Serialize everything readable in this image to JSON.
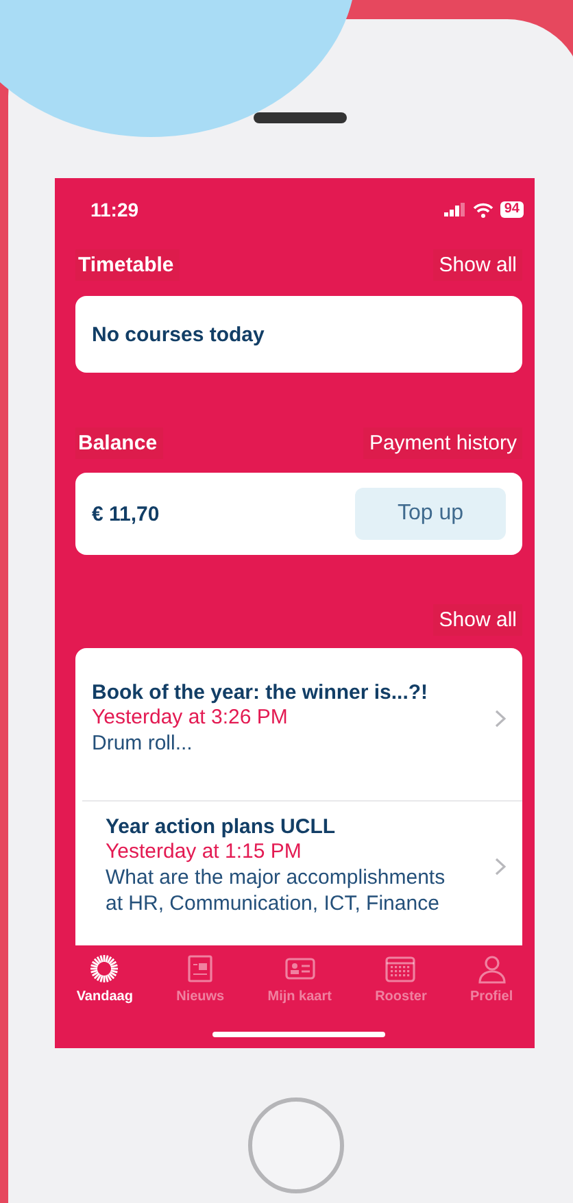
{
  "status_bar": {
    "time": "11:29",
    "battery": "94"
  },
  "timetable": {
    "title": "Timetable",
    "action": "Show all",
    "message": "No courses today"
  },
  "balance": {
    "title": "Balance",
    "action": "Payment history",
    "amount": "€ 11,70",
    "button": "Top up"
  },
  "news": {
    "action": "Show all",
    "items": [
      {
        "title": "Book of the year: the winner is...?!",
        "time": "Yesterday at 3:26 PM",
        "summary": "Drum roll..."
      },
      {
        "title": "Year action plans UCLL",
        "time": "Yesterday at 1:15 PM",
        "summary": "What are the major accomplishments at HR, Communication, ICT, Finance"
      }
    ]
  },
  "tab_bar": [
    {
      "kind": "sun",
      "label": "Vandaag",
      "selected": true
    },
    {
      "kind": "news",
      "label": "Nieuws",
      "selected": false
    },
    {
      "kind": "card",
      "label": "Mijn kaart",
      "selected": false
    },
    {
      "kind": "calendar",
      "label": "Rooster",
      "selected": false
    },
    {
      "kind": "person",
      "label": "Profiel",
      "selected": false
    }
  ]
}
